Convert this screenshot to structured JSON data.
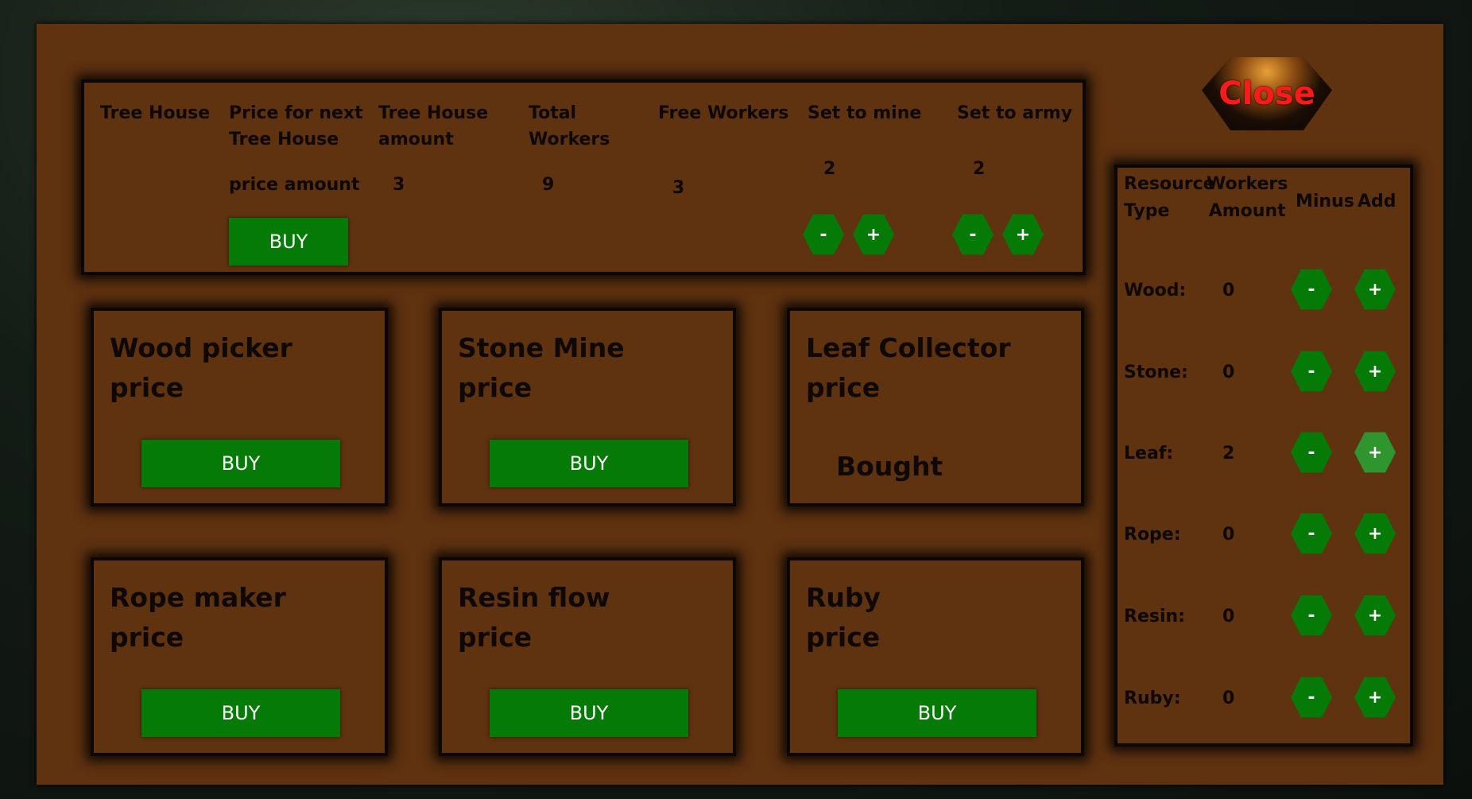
{
  "close_label": "Close",
  "treehouse": {
    "headers": [
      "Tree House",
      "Price for next\nTree House",
      "Tree House\namount",
      "Total\nWorkers",
      "Free Workers",
      "Set to mine",
      "Set to army"
    ],
    "price_amount": "price amount",
    "treehouse_amount": "3",
    "total_workers": "9",
    "free_workers": "3",
    "set_to_mine": "2",
    "set_to_army": "2",
    "buy_label": "BUY",
    "minus": "-",
    "plus": "+"
  },
  "cards": [
    {
      "name": "Wood picker",
      "price": "price",
      "action": "BUY"
    },
    {
      "name": "Stone Mine",
      "price": "price",
      "action": "BUY"
    },
    {
      "name": "Leaf Collector",
      "price": "price",
      "status": "Bought"
    },
    {
      "name": "Rope maker",
      "price": "price",
      "action": "BUY"
    },
    {
      "name": "Resin flow",
      "price": "price",
      "action": "BUY"
    },
    {
      "name": "Ruby",
      "price": "price",
      "action": "BUY"
    }
  ],
  "resources": {
    "col_type": "Resource\nType",
    "col_workers": "Workers\nAmount",
    "col_minus": "Minus",
    "col_add": "Add",
    "minus": "-",
    "plus": "+",
    "rows": [
      {
        "label": "Wood:",
        "amount": "0"
      },
      {
        "label": "Stone:",
        "amount": "0"
      },
      {
        "label": "Leaf:",
        "amount": "2"
      },
      {
        "label": "Rope:",
        "amount": "0"
      },
      {
        "label": "Resin:",
        "amount": "0"
      },
      {
        "label": "Ruby:",
        "amount": "0"
      }
    ]
  },
  "colors": {
    "panel": "#5f3210",
    "button": "#067a06",
    "close_text": "#ff1a1a"
  }
}
